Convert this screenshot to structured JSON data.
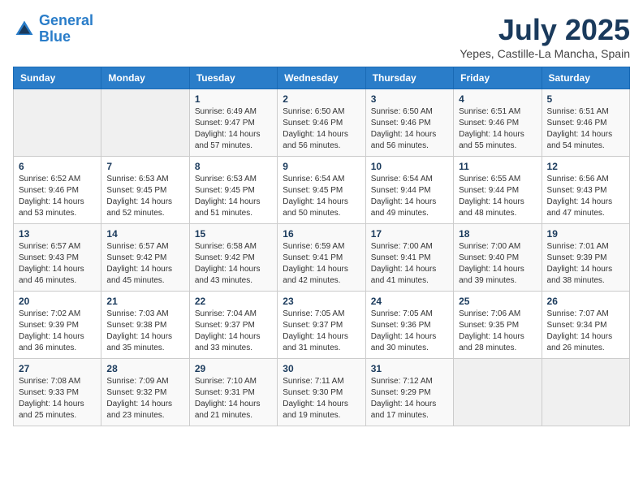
{
  "logo": {
    "line1": "General",
    "line2": "Blue"
  },
  "calendar": {
    "title": "July 2025",
    "subtitle": "Yepes, Castille-La Mancha, Spain"
  },
  "weekdays": [
    "Sunday",
    "Monday",
    "Tuesday",
    "Wednesday",
    "Thursday",
    "Friday",
    "Saturday"
  ],
  "weeks": [
    [
      {
        "day": "",
        "info": ""
      },
      {
        "day": "",
        "info": ""
      },
      {
        "day": "1",
        "info": "Sunrise: 6:49 AM\nSunset: 9:47 PM\nDaylight: 14 hours and 57 minutes."
      },
      {
        "day": "2",
        "info": "Sunrise: 6:50 AM\nSunset: 9:46 PM\nDaylight: 14 hours and 56 minutes."
      },
      {
        "day": "3",
        "info": "Sunrise: 6:50 AM\nSunset: 9:46 PM\nDaylight: 14 hours and 56 minutes."
      },
      {
        "day": "4",
        "info": "Sunrise: 6:51 AM\nSunset: 9:46 PM\nDaylight: 14 hours and 55 minutes."
      },
      {
        "day": "5",
        "info": "Sunrise: 6:51 AM\nSunset: 9:46 PM\nDaylight: 14 hours and 54 minutes."
      }
    ],
    [
      {
        "day": "6",
        "info": "Sunrise: 6:52 AM\nSunset: 9:46 PM\nDaylight: 14 hours and 53 minutes."
      },
      {
        "day": "7",
        "info": "Sunrise: 6:53 AM\nSunset: 9:45 PM\nDaylight: 14 hours and 52 minutes."
      },
      {
        "day": "8",
        "info": "Sunrise: 6:53 AM\nSunset: 9:45 PM\nDaylight: 14 hours and 51 minutes."
      },
      {
        "day": "9",
        "info": "Sunrise: 6:54 AM\nSunset: 9:45 PM\nDaylight: 14 hours and 50 minutes."
      },
      {
        "day": "10",
        "info": "Sunrise: 6:54 AM\nSunset: 9:44 PM\nDaylight: 14 hours and 49 minutes."
      },
      {
        "day": "11",
        "info": "Sunrise: 6:55 AM\nSunset: 9:44 PM\nDaylight: 14 hours and 48 minutes."
      },
      {
        "day": "12",
        "info": "Sunrise: 6:56 AM\nSunset: 9:43 PM\nDaylight: 14 hours and 47 minutes."
      }
    ],
    [
      {
        "day": "13",
        "info": "Sunrise: 6:57 AM\nSunset: 9:43 PM\nDaylight: 14 hours and 46 minutes."
      },
      {
        "day": "14",
        "info": "Sunrise: 6:57 AM\nSunset: 9:42 PM\nDaylight: 14 hours and 45 minutes."
      },
      {
        "day": "15",
        "info": "Sunrise: 6:58 AM\nSunset: 9:42 PM\nDaylight: 14 hours and 43 minutes."
      },
      {
        "day": "16",
        "info": "Sunrise: 6:59 AM\nSunset: 9:41 PM\nDaylight: 14 hours and 42 minutes."
      },
      {
        "day": "17",
        "info": "Sunrise: 7:00 AM\nSunset: 9:41 PM\nDaylight: 14 hours and 41 minutes."
      },
      {
        "day": "18",
        "info": "Sunrise: 7:00 AM\nSunset: 9:40 PM\nDaylight: 14 hours and 39 minutes."
      },
      {
        "day": "19",
        "info": "Sunrise: 7:01 AM\nSunset: 9:39 PM\nDaylight: 14 hours and 38 minutes."
      }
    ],
    [
      {
        "day": "20",
        "info": "Sunrise: 7:02 AM\nSunset: 9:39 PM\nDaylight: 14 hours and 36 minutes."
      },
      {
        "day": "21",
        "info": "Sunrise: 7:03 AM\nSunset: 9:38 PM\nDaylight: 14 hours and 35 minutes."
      },
      {
        "day": "22",
        "info": "Sunrise: 7:04 AM\nSunset: 9:37 PM\nDaylight: 14 hours and 33 minutes."
      },
      {
        "day": "23",
        "info": "Sunrise: 7:05 AM\nSunset: 9:37 PM\nDaylight: 14 hours and 31 minutes."
      },
      {
        "day": "24",
        "info": "Sunrise: 7:05 AM\nSunset: 9:36 PM\nDaylight: 14 hours and 30 minutes."
      },
      {
        "day": "25",
        "info": "Sunrise: 7:06 AM\nSunset: 9:35 PM\nDaylight: 14 hours and 28 minutes."
      },
      {
        "day": "26",
        "info": "Sunrise: 7:07 AM\nSunset: 9:34 PM\nDaylight: 14 hours and 26 minutes."
      }
    ],
    [
      {
        "day": "27",
        "info": "Sunrise: 7:08 AM\nSunset: 9:33 PM\nDaylight: 14 hours and 25 minutes."
      },
      {
        "day": "28",
        "info": "Sunrise: 7:09 AM\nSunset: 9:32 PM\nDaylight: 14 hours and 23 minutes."
      },
      {
        "day": "29",
        "info": "Sunrise: 7:10 AM\nSunset: 9:31 PM\nDaylight: 14 hours and 21 minutes."
      },
      {
        "day": "30",
        "info": "Sunrise: 7:11 AM\nSunset: 9:30 PM\nDaylight: 14 hours and 19 minutes."
      },
      {
        "day": "31",
        "info": "Sunrise: 7:12 AM\nSunset: 9:29 PM\nDaylight: 14 hours and 17 minutes."
      },
      {
        "day": "",
        "info": ""
      },
      {
        "day": "",
        "info": ""
      }
    ]
  ]
}
